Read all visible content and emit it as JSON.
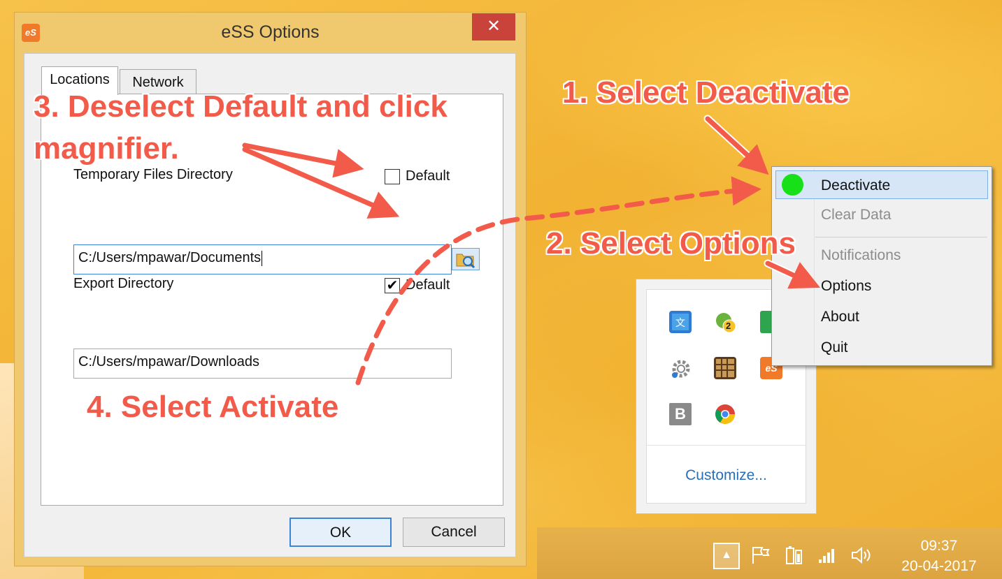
{
  "dialog": {
    "title": "eSS Options",
    "app_icon_text": "eS",
    "close_label": "✕",
    "tabs": [
      {
        "label": "Locations"
      },
      {
        "label": "Network"
      }
    ],
    "temp_dir": {
      "label": "Temporary Files Directory",
      "default_label": "Default",
      "default_checked": false,
      "value": "C:/Users/mpawar/Documents"
    },
    "export_dir": {
      "label": "Export Directory",
      "default_label": "Default",
      "default_checked": true,
      "value": "C:/Users/mpawar/Downloads"
    },
    "ok_label": "OK",
    "cancel_label": "Cancel"
  },
  "context_menu": {
    "items": [
      {
        "label": "Deactivate",
        "disabled": false
      },
      {
        "label": "Clear Data",
        "disabled": true
      },
      {
        "label": "Notifications",
        "disabled": true
      },
      {
        "label": "Options",
        "disabled": false
      },
      {
        "label": "About",
        "disabled": false
      },
      {
        "label": "Quit",
        "disabled": false
      }
    ]
  },
  "tray_popup": {
    "badge_count": "2",
    "ess_icon_text": "eS",
    "b_icon_text": "B",
    "customize_label": "Customize..."
  },
  "taskbar": {
    "time": "09:37",
    "date": "20-04-2017"
  },
  "annotations": {
    "step1": "1. Select Deactivate",
    "step2": "2. Select Options",
    "step3_line1": "3. Deselect Default and click",
    "step3_line2": "magnifier.",
    "step4": "4. Select Activate"
  },
  "colors": {
    "annotation_red": "#f25a4a",
    "highlight_blue": "#3c84d6",
    "status_green": "#18e018",
    "close_red": "#c9433a"
  }
}
